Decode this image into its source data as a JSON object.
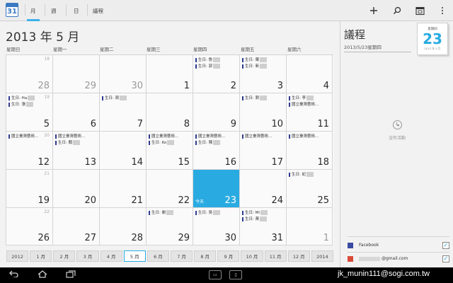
{
  "app": {
    "icon_number": "31"
  },
  "view_tabs": [
    "月",
    "週",
    "日",
    "議程"
  ],
  "title": "2013 年 5 月",
  "weekdays": [
    "星期日",
    "星期一",
    "星期二",
    "星期三",
    "星期四",
    "星期五",
    "星期六"
  ],
  "calendar": {
    "today_label": "今天",
    "weeks": [
      [
        {
          "d": "28",
          "c": "18",
          "o": true
        },
        {
          "d": "29",
          "o": true
        },
        {
          "d": "30",
          "o": true
        },
        {
          "d": "1"
        },
        {
          "d": "2"
        },
        {
          "d": "3"
        },
        {
          "d": "4"
        }
      ],
      [
        {
          "d": "5",
          "c": "19"
        },
        {
          "d": "6"
        },
        {
          "d": "7"
        },
        {
          "d": "8"
        },
        {
          "d": "9"
        },
        {
          "d": "10"
        },
        {
          "d": "11"
        }
      ],
      [
        {
          "d": "12",
          "c": "20"
        },
        {
          "d": "13"
        },
        {
          "d": "14"
        },
        {
          "d": "15"
        },
        {
          "d": "16"
        },
        {
          "d": "17"
        },
        {
          "d": "18"
        }
      ],
      [
        {
          "d": "19",
          "c": "21"
        },
        {
          "d": "20"
        },
        {
          "d": "21"
        },
        {
          "d": "22"
        },
        {
          "d": "23",
          "today": true
        },
        {
          "d": "24"
        },
        {
          "d": "25"
        }
      ],
      [
        {
          "d": "26",
          "c": "22"
        },
        {
          "d": "27"
        },
        {
          "d": "28"
        },
        {
          "d": "29"
        },
        {
          "d": "30"
        },
        {
          "d": "31"
        },
        {
          "d": "1",
          "o": true
        }
      ]
    ],
    "events": [
      {
        "w": 0,
        "c": 4,
        "i": 0,
        "t": "生日: 詹"
      },
      {
        "w": 0,
        "c": 4,
        "i": 1,
        "t": "生日: 郭"
      },
      {
        "w": 0,
        "c": 5,
        "i": 0,
        "t": "生日: 葉"
      },
      {
        "w": 0,
        "c": 5,
        "i": 1,
        "t": "生日: 新"
      },
      {
        "w": 1,
        "c": 0,
        "i": 0,
        "t": "生日: Ha"
      },
      {
        "w": 1,
        "c": 0,
        "i": 1,
        "t": "生日: 張"
      },
      {
        "w": 1,
        "c": 2,
        "i": 0,
        "t": "生日: 周"
      },
      {
        "w": 1,
        "c": 5,
        "i": 0,
        "t": "生日: 劉"
      },
      {
        "w": 1,
        "c": 6,
        "i": 0,
        "t": "生日: 李"
      },
      {
        "w": 1,
        "c": 6,
        "i": 1,
        "t": "國立臺灣藝術..."
      },
      {
        "w": 2,
        "c": 0,
        "i": 0,
        "t": "國立臺灣藝術..."
      },
      {
        "w": 2,
        "c": 1,
        "i": 0,
        "t": "國立臺灣藝術..."
      },
      {
        "w": 2,
        "c": 1,
        "i": 1,
        "t": "生日: 顏"
      },
      {
        "w": 2,
        "c": 3,
        "i": 0,
        "t": "國立臺灣藝術..."
      },
      {
        "w": 2,
        "c": 3,
        "i": 1,
        "t": "生日: Ko"
      },
      {
        "w": 2,
        "c": 4,
        "i": 0,
        "t": "國立臺灣藝術..."
      },
      {
        "w": 2,
        "c": 4,
        "i": 1,
        "t": "生日: 陳"
      },
      {
        "w": 2,
        "c": 5,
        "i": 0,
        "t": "國立臺灣藝術..."
      },
      {
        "w": 2,
        "c": 6,
        "i": 0,
        "t": "國立臺灣藝術..."
      },
      {
        "w": 3,
        "c": 6,
        "i": 0,
        "t": "生日: 紀"
      },
      {
        "w": 4,
        "c": 3,
        "i": 0,
        "t": "生日: 謝"
      },
      {
        "w": 4,
        "c": 4,
        "i": 0,
        "t": "生日: 吳"
      },
      {
        "w": 4,
        "c": 5,
        "i": 0,
        "t": "生日: Mi"
      },
      {
        "w": 4,
        "c": 5,
        "i": 1,
        "t": "生日: 黃"
      }
    ]
  },
  "agenda": {
    "title": "議程",
    "date": "2013/5/23星期四",
    "tile_weekday": "星期四",
    "tile_day": "23",
    "tile_small": "2013 年 5 月",
    "empty_text": "沒有活動"
  },
  "accounts": [
    {
      "label": "Facebook",
      "color": "#3b4aa3",
      "checked": true
    },
    {
      "label": "@gmail.com",
      "color": "#d84a38",
      "checked": true
    }
  ],
  "month_strip": [
    "2012",
    "1 月",
    "2 月",
    "3 月",
    "4 月",
    "5 月",
    "6 月",
    "7 月",
    "8 月",
    "9 月",
    "10 月",
    "11 月",
    "12 月",
    "2014"
  ],
  "month_strip_active": 5,
  "watermark": "jk_munin111@sogi.com.tw",
  "colors": {
    "accent": "#29abe2",
    "event_bar": "#2f3c8f"
  }
}
